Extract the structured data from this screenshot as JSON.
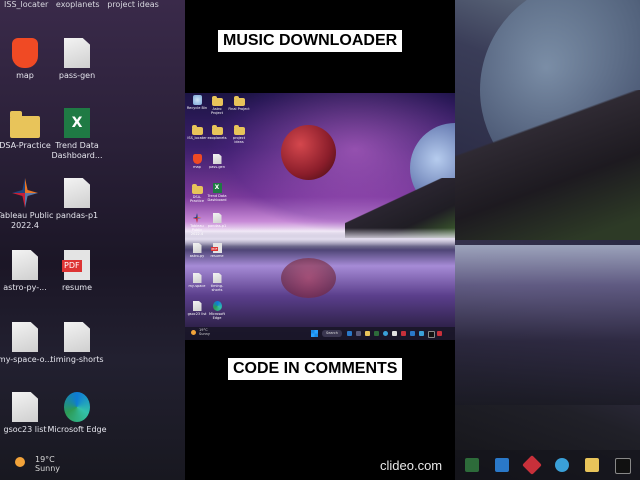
{
  "captions": {
    "top": "MUSIC DOWNLOADER",
    "bottom": "CODE IN COMMENTS"
  },
  "background_left": {
    "title_items": [
      "ISS_locater",
      "exoplanets",
      "project ideas"
    ],
    "icons": [
      {
        "label": "map",
        "icon": "brave-icon"
      },
      {
        "label": "pass-gen",
        "icon": "document-icon"
      },
      {
        "label": "DSA-Practice",
        "icon": "folder-icon"
      },
      {
        "label": "Trend Data Dashboard...",
        "icon": "excel-icon"
      },
      {
        "label": "Tableau Public 2022.4",
        "icon": "tableau-icon"
      },
      {
        "label": "pandas-p1",
        "icon": "document-icon"
      },
      {
        "label": "astro-py-...",
        "icon": "document-icon"
      },
      {
        "label": "resume",
        "icon": "pdf-icon"
      },
      {
        "label": "my-space-o...",
        "icon": "document-icon"
      },
      {
        "label": "timing-shorts",
        "icon": "document-icon"
      },
      {
        "label": "gsoc23 list",
        "icon": "document-icon"
      },
      {
        "label": "Microsoft Edge",
        "icon": "edge-icon"
      }
    ],
    "weather": {
      "temp": "19°C",
      "condition": "Sunny"
    }
  },
  "screen": {
    "desktop_icons": [
      {
        "label": "Recycle Bin",
        "icon": "recycle-bin-icon"
      },
      {
        "label": "Astro Project",
        "icon": "folder-icon"
      },
      {
        "label": "Final Project",
        "icon": "folder-icon"
      },
      {
        "label": "ISS_locater",
        "icon": "folder-icon"
      },
      {
        "label": "exoplanets",
        "icon": "folder-icon"
      },
      {
        "label": "project ideas",
        "icon": "folder-icon"
      },
      {
        "label": "map",
        "icon": "brave-icon"
      },
      {
        "label": "pass-gen",
        "icon": "document-icon"
      },
      {
        "label": "DSA-Practice",
        "icon": "folder-icon"
      },
      {
        "label": "Trend Data Dashboard",
        "icon": "excel-icon"
      },
      {
        "label": "Tableau Public 2022.4",
        "icon": "tableau-icon"
      },
      {
        "label": "pandas-p1",
        "icon": "document-icon"
      },
      {
        "label": "astro-py",
        "icon": "document-icon"
      },
      {
        "label": "resume",
        "icon": "pdf-icon"
      },
      {
        "label": "my-space",
        "icon": "document-icon"
      },
      {
        "label": "timing-shorts",
        "icon": "document-icon"
      },
      {
        "label": "gsoc23 list",
        "icon": "document-icon"
      },
      {
        "label": "Microsoft Edge",
        "icon": "edge-icon"
      }
    ],
    "taskbar": {
      "weather_temp": "19°C",
      "weather_condition": "Sunny",
      "search_label": "Search"
    }
  },
  "watermark": "clideo.com",
  "colors": {
    "caption_bg": "#ffffff",
    "caption_text": "#000000"
  }
}
